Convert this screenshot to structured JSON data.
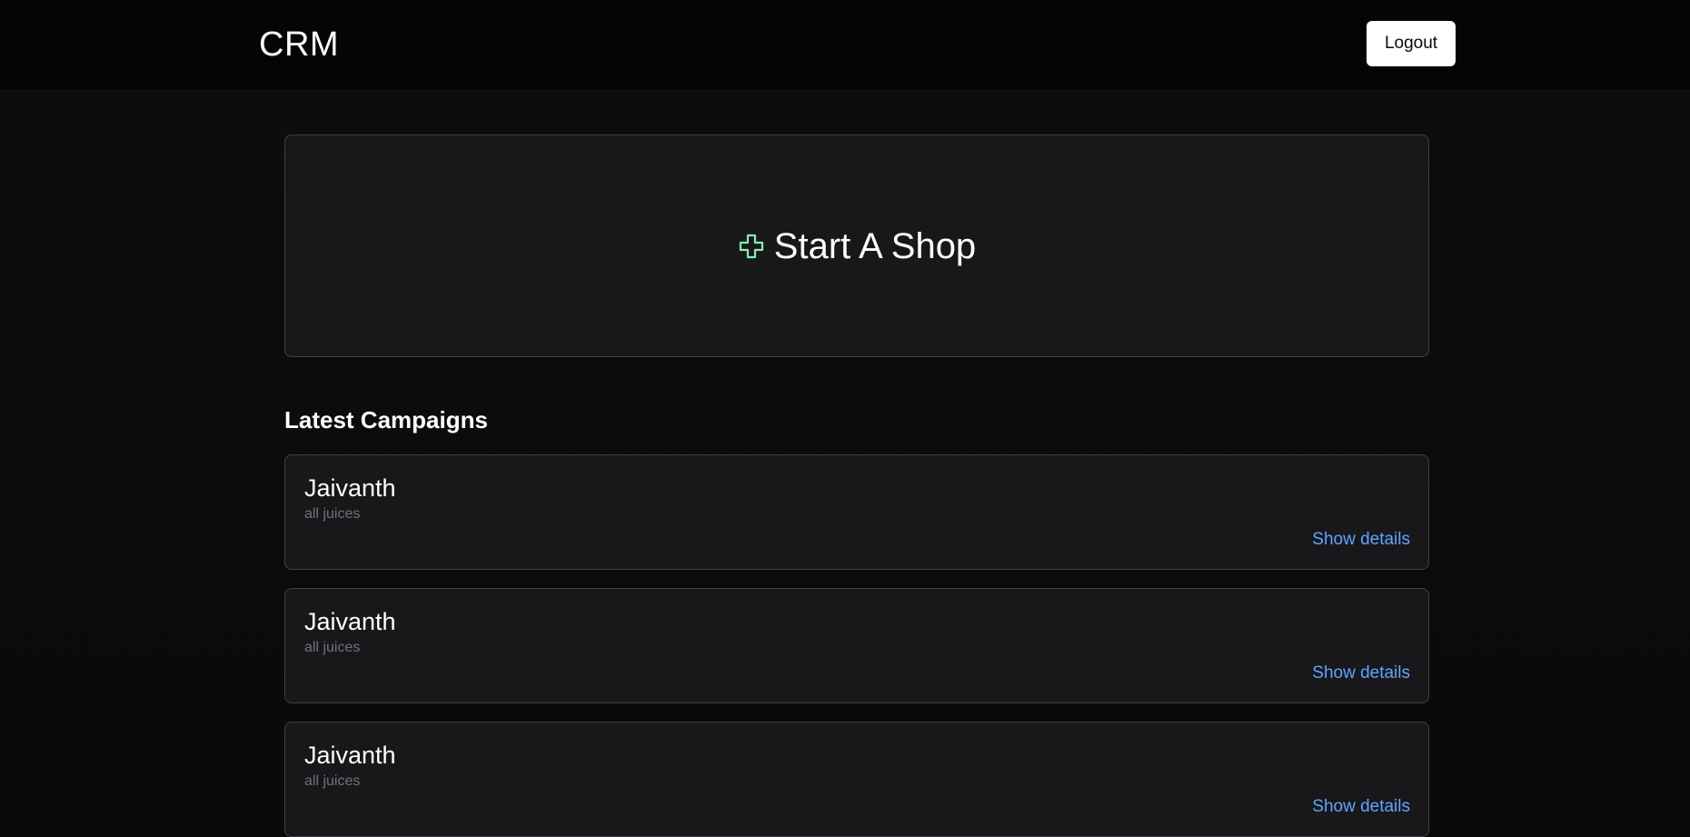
{
  "header": {
    "brand": "CRM",
    "logout_label": "Logout"
  },
  "start_card": {
    "label": "Start A Shop",
    "icon": "plus-icon",
    "icon_color": "#86efac"
  },
  "campaigns_section": {
    "title": "Latest Campaigns",
    "items": [
      {
        "name": "Jaivanth",
        "description": "all juices",
        "link_label": "Show details"
      },
      {
        "name": "Jaivanth",
        "description": "all juices",
        "link_label": "Show details"
      },
      {
        "name": "Jaivanth",
        "description": "all juices",
        "link_label": "Show details"
      }
    ]
  },
  "colors": {
    "background": "#0a0a0c",
    "card": "#18181b",
    "card_border": "#3f3f46",
    "link": "#60a5fa",
    "muted_text": "#71717a"
  }
}
